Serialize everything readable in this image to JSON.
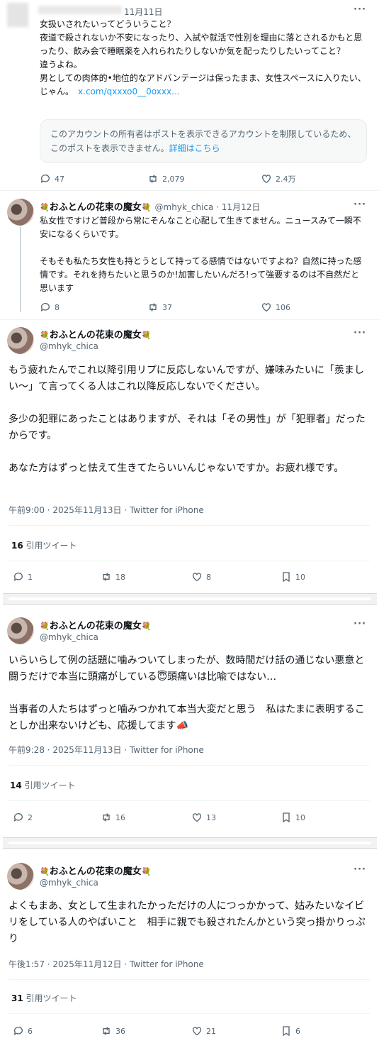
{
  "tweet0": {
    "date": "11月11日",
    "text": "女扱いされたいってどういうこと？\n夜道で殺されないか不安になったり、入試や就活で性別を理由に落とされるかもと思ったり、飲み会で睡眠薬を入れられたりしないか気を配ったりしたいってこと？\n違うよね。\n男としての肉体的•地位的なアドバンテージは保ったまま、女性スペースに入りたい、じゃん。",
    "link": "x.com/qxxxo0__0oxxx…",
    "notice_text": "このアカウントの所有者はポストを表示できるアカウントを制限しているため、このポストを表示できません。",
    "notice_link": "詳細はこちら",
    "replies": "47",
    "retweets": "2,079",
    "likes": "2.4万"
  },
  "tweet1": {
    "name": "おふとんの花束の魔女",
    "handle": "@mhyk_chica · 11月12日",
    "text": "私女性ですけど普段から常にそんなこと心配して生きてません。ニュースみて一瞬不安になるくらいです。\n\nそもそも私たち女性も持とうとして持ってる感情ではないですよね？自然に持った感情です。それを持ちたいと思うのか!加害したいんだろ!って強要するのは不自然だと思います",
    "replies": "8",
    "retweets": "37",
    "likes": "106"
  },
  "tweet2": {
    "name": "おふとんの花束の魔女",
    "handle": "@mhyk_chica",
    "text": "もう疲れたんでこれ以降引用リプに反応しないんですが、嫌味みたいに「羨ましい〜」て言ってくる人はこれ以降反応しないでください。\n\n多少の犯罪にあったことはありますが、それは「その男性」が「犯罪者」だったからです。\n\nあなた方はずっと怯えて生きてたらいいんじゃないですか。お疲れ様です。",
    "meta": "午前9:00 · 2025年11月13日 · Twitter for iPhone",
    "quote_count": "16",
    "quote_label": "引用ツイート",
    "replies": "1",
    "retweets": "18",
    "likes": "8",
    "bookmarks": "10"
  },
  "tweet3": {
    "name": "おふとんの花束の魔女",
    "handle": "@mhyk_chica",
    "text": "いらいらして例の話題に噛みついてしまったが、数時間だけ話の通じない悪意と闘うだけで本当に頭痛がしている😇頭痛いは比喩ではない…\n\n当事者の人たちはずっと噛みつかれて本当大変だと思う　私はたまに表明することしか出来ないけども、応援してます📣",
    "meta": "午前9:28 · 2025年11月13日 · Twitter for iPhone",
    "quote_count": "14",
    "quote_label": "引用ツイート",
    "replies": "2",
    "retweets": "16",
    "likes": "13",
    "bookmarks": "10"
  },
  "tweet4": {
    "name": "おふとんの花束の魔女",
    "handle": "@mhyk_chica",
    "text": "よくもまあ、女として生まれたかっただけの人につっかかって、姑みたいなイビリをしている人のやばいこと　相手に親でも殺されたんかという突っ掛かりっぷり",
    "meta": "午後1:57 · 2025年11月12日 · Twitter for iPhone",
    "quote_count": "31",
    "quote_label": "引用ツイート",
    "replies": "6",
    "retweets": "36",
    "likes": "21",
    "bookmarks": "6"
  },
  "more_icon": "···"
}
